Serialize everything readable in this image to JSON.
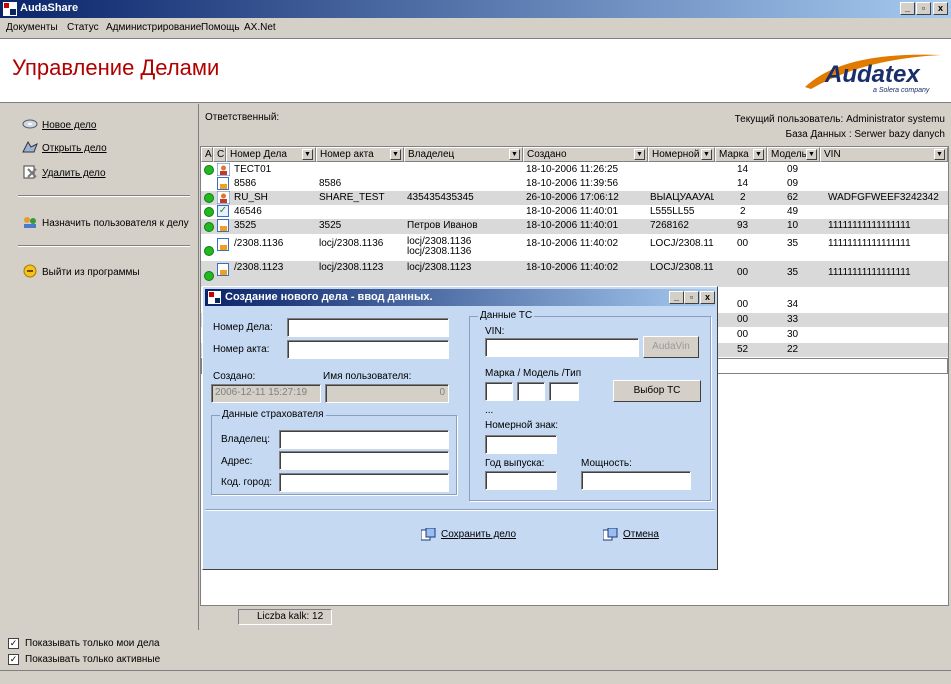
{
  "window": {
    "title": "AudaShare",
    "controls": [
      "_",
      "ð",
      "x"
    ]
  },
  "menu": [
    "Документы",
    "Статус",
    "Администрирование",
    "Помощь",
    "AX.Net"
  ],
  "header": {
    "title": "Управление Делами",
    "logo_text": "Audatex",
    "logo_sub": "a Solera company"
  },
  "sidebar": {
    "items": [
      {
        "label": "Новое дело",
        "icon": "disc-icon"
      },
      {
        "label": "Открыть дело",
        "icon": "open-case-icon"
      },
      {
        "label": "Удалить дело",
        "icon": "delete-case-icon"
      },
      {
        "label": "Назначить пользователя к делу",
        "icon": "assign-user-icon"
      },
      {
        "label": "Выйти из программы",
        "icon": "exit-icon"
      }
    ]
  },
  "main": {
    "responsible_label": "Ответственный:",
    "current_user": "Текущий пользователь: Administrator systemu",
    "database": "База Данных : Serwer bazy danych",
    "columns": [
      "A",
      "C",
      "Номер Дела",
      "Номер акта",
      "Владелец",
      "Создано",
      "Номерной з",
      "Марка",
      "Модель",
      "VIN"
    ],
    "rows": [
      {
        "status": "person",
        "case": "TECT01",
        "act": "",
        "owner": "",
        "created": "18-10-2006 11:26:25",
        "plate": "",
        "make": "14",
        "model": "09",
        "vin": ""
      },
      {
        "status": "doc",
        "case": "8586",
        "act": "8586",
        "owner": "",
        "created": "18-10-2006 11:39:56",
        "plate": "",
        "make": "14",
        "model": "09",
        "vin": ""
      },
      {
        "status": "person",
        "case": "RU_SH",
        "act": "SHARE_TEST",
        "owner": "435435435345",
        "created": "26-10-2006 17:06:12",
        "plate": "ВЫАЦУААУАЦ",
        "make": "2",
        "model": "62",
        "vin": "WADFGFWEEF3242342"
      },
      {
        "status": "check",
        "case": "46546",
        "act": "",
        "owner": "",
        "created": "18-10-2006 11:40:01",
        "plate": "L555LL55",
        "make": "2",
        "model": "49",
        "vin": ""
      },
      {
        "status": "doc",
        "case": "3525",
        "act": "3525",
        "owner": "Петров Иванов",
        "created": "18-10-2006 11:40:01",
        "plate": "7268162",
        "make": "93",
        "model": "10",
        "vin": "11111111111111111"
      },
      {
        "status": "doc",
        "case": "/2308.1136",
        "act": "locj/2308.1136",
        "owner": "locj/2308.1136",
        "owner2": "locj/2308.1136",
        "created": "18-10-2006 11:40:02",
        "plate": "LOCJ/2308.11",
        "make": "00",
        "model": "35",
        "vin": "11111111111111111"
      },
      {
        "status": "doc",
        "case": "/2308.1123",
        "act": "locj/2308.1123",
        "owner": "locj/2308.1123",
        "created": "18-10-2006 11:40:02",
        "plate": "LOCJ/2308.11",
        "make": "00",
        "model": "35",
        "vin": "11111111111111111"
      },
      {
        "status": "",
        "case": "",
        "act": "",
        "owner": "",
        "created": "",
        "plate": "",
        "make": "00",
        "model": "34",
        "vin": ""
      },
      {
        "status": "",
        "case": "",
        "act": "",
        "owner": "",
        "created": "",
        "plate": "",
        "make": "00",
        "model": "33",
        "vin": ""
      },
      {
        "status": "",
        "case": "",
        "act": "",
        "owner": "",
        "created": "",
        "plate": "",
        "make": "00",
        "model": "30",
        "vin": ""
      },
      {
        "status": "",
        "case": "",
        "act": "",
        "owner": "",
        "created": "",
        "plate": "",
        "make": "52",
        "model": "22",
        "vin": ""
      }
    ],
    "count_label": "Liczba kalk:",
    "count_value": "12"
  },
  "filters": [
    {
      "label": "Показывать только мои дела",
      "checked": true
    },
    {
      "label": "Показывать только активные",
      "checked": true
    }
  ],
  "dialog": {
    "title": "Создание нового дела - ввод данных.",
    "case_no_label": "Номер Дела:",
    "act_no_label": "Номер акта:",
    "created_label": "Создано:",
    "created_value": "2006-12-11 15:27:19",
    "user_label": "Имя пользователя:",
    "user_value": "0",
    "insured_group": "Данные страхователя",
    "owner_label": "Владелец:",
    "address_label": "Адрес:",
    "city_label": "Код. город:",
    "vehicle_group": "Данные ТС",
    "vin_label": "VIN:",
    "audavin_button": "AudaVin",
    "mmt_label": "Марка / Модель /Тип",
    "select_vehicle_button": "Выбор ТС",
    "ellipsis": "...",
    "plate_label": "Номерной знак:",
    "year_label": "Год выпуска:",
    "power_label": "Мощность:",
    "save_button": "Сохранить дело",
    "cancel_button": "Отмена"
  }
}
